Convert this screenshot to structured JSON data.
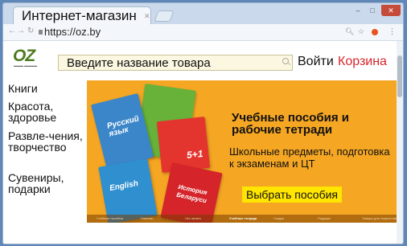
{
  "window": {
    "tab_title": "Интернет-магазин",
    "url": "https://oz.by"
  },
  "header": {
    "logo_text": "OZ",
    "search_placeholder": "Введите название товара",
    "login_label": "Войти",
    "cart_label": "Корзина"
  },
  "sidebar": {
    "items": [
      {
        "label": "Книги"
      },
      {
        "label": "Красота, здоровье"
      },
      {
        "label": "Развле-чения, творчество"
      },
      {
        "label": "Сувениры, подарки"
      }
    ]
  },
  "banner": {
    "title": "Учебные пособия и рабочие тетради",
    "subtitle": "Школьные предметы, подготовка к экзаменам и ЦТ",
    "cta_label": "Выбрать пособия",
    "book_labels": [
      "Русский язык",
      "5+1",
      "English",
      "История Беларуси"
    ],
    "slider_tabs": [
      {
        "label": "Учебные пособия",
        "active": false
      },
      {
        "label": "Новинки",
        "active": false
      },
      {
        "label": "Что читать",
        "active": false
      },
      {
        "label": "Учебные тетради",
        "active": true
      },
      {
        "label": "Скидки",
        "active": false
      },
      {
        "label": "Подарки",
        "active": false
      },
      {
        "label": "Товары для творчества",
        "active": false
      }
    ]
  },
  "colors": {
    "brand_green": "#4e7a1e",
    "cart_red": "#d7262c",
    "banner_orange": "#f5a623",
    "cta_yellow": "#ffe500"
  }
}
